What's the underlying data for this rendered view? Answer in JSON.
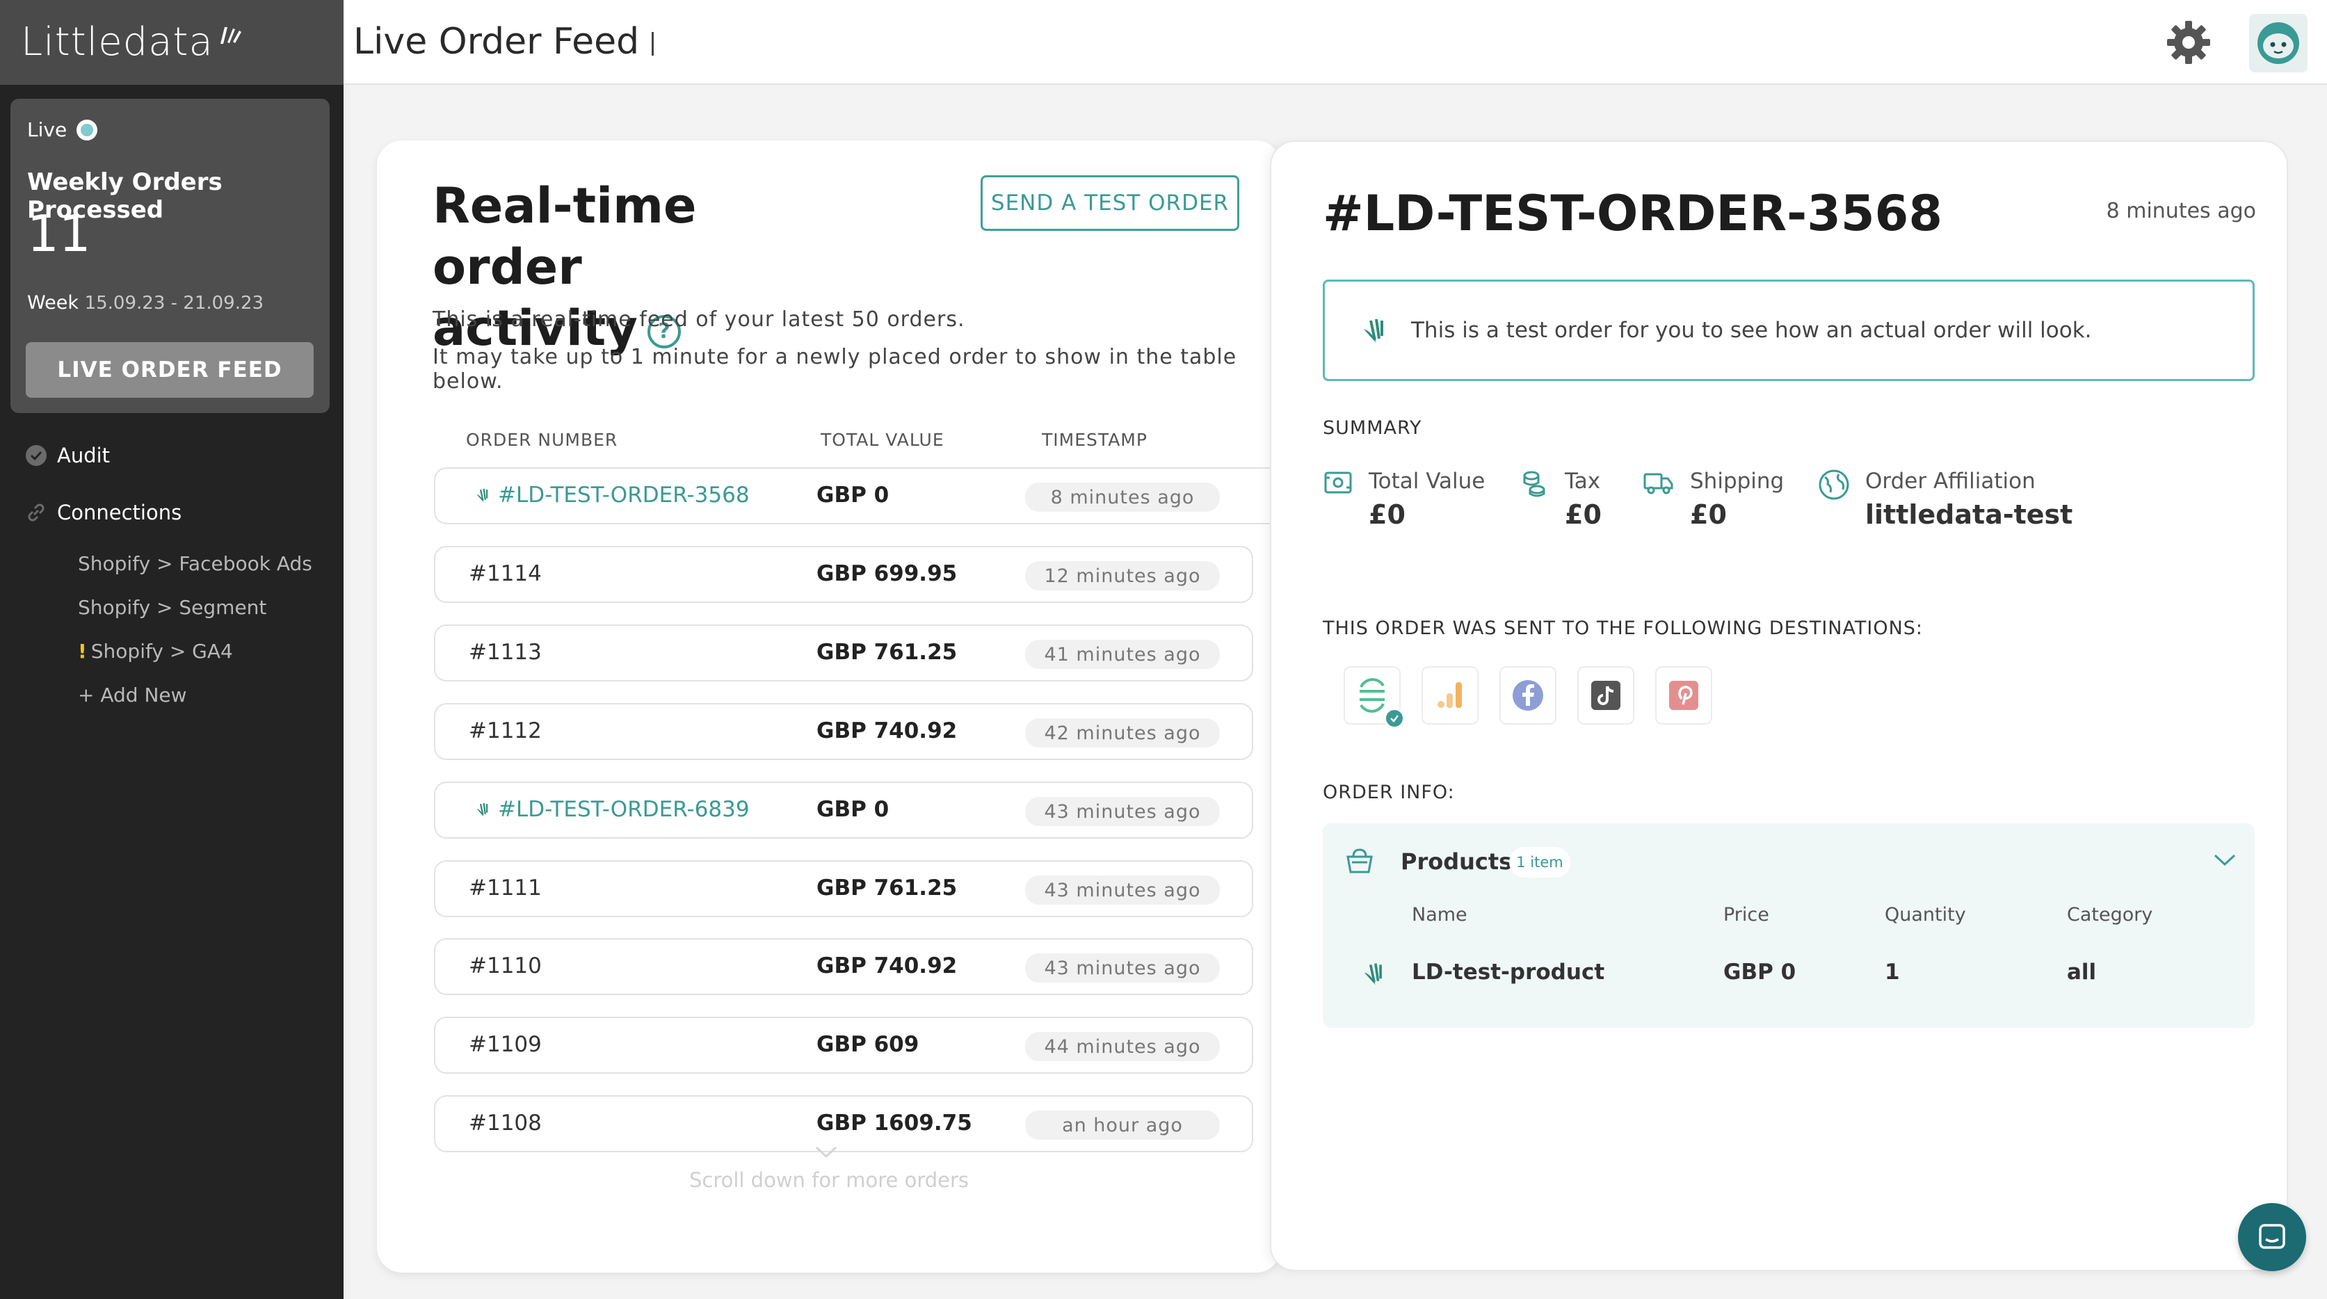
{
  "app": {
    "logo": "Littledata",
    "page_title": "Live Order Feed"
  },
  "sidebar": {
    "live_label": "Live",
    "stat_title": "Weekly Orders Processed",
    "stat_value": "11",
    "week_label": "Week",
    "week_dates": "15.09.23 - 21.09.23",
    "live_feed_button": "LIVE ORDER FEED",
    "nav": [
      {
        "label": "Audit",
        "icon": "check-circle-icon"
      },
      {
        "label": "Connections",
        "icon": "link-icon"
      }
    ],
    "connections": [
      {
        "label": "Shopify > Facebook Ads",
        "warning": ""
      },
      {
        "label": "Shopify > Segment",
        "warning": ""
      },
      {
        "label": "Shopify > GA4",
        "warning": "!"
      },
      {
        "label": "+ Add New",
        "warning": ""
      }
    ]
  },
  "feed": {
    "title_line1": "Real-time order",
    "title_line2": "activity",
    "help_glyph": "?",
    "send_test_button": "SEND A TEST ORDER",
    "desc1": "This is a real-time feed of your latest 50 orders.",
    "desc2": "It may take up to 1 minute for a newly placed order to show in the table below.",
    "columns": [
      "ORDER NUMBER",
      "TOTAL VALUE",
      "TIMESTAMP"
    ],
    "rows": [
      {
        "order": "#LD-TEST-ORDER-3568",
        "value": "GBP 0",
        "time": "8 minutes ago",
        "test": true,
        "selected": true
      },
      {
        "order": "#1114",
        "value": "GBP 699.95",
        "time": "12 minutes ago",
        "test": false,
        "selected": false
      },
      {
        "order": "#1113",
        "value": "GBP 761.25",
        "time": "41 minutes ago",
        "test": false,
        "selected": false
      },
      {
        "order": "#1112",
        "value": "GBP 740.92",
        "time": "42 minutes ago",
        "test": false,
        "selected": false
      },
      {
        "order": "#LD-TEST-ORDER-6839",
        "value": "GBP 0",
        "time": "43 minutes ago",
        "test": true,
        "selected": false
      },
      {
        "order": "#1111",
        "value": "GBP 761.25",
        "time": "43 minutes ago",
        "test": false,
        "selected": false
      },
      {
        "order": "#1110",
        "value": "GBP 740.92",
        "time": "43 minutes ago",
        "test": false,
        "selected": false
      },
      {
        "order": "#1109",
        "value": "GBP 609",
        "time": "44 minutes ago",
        "test": false,
        "selected": false
      },
      {
        "order": "#1108",
        "value": "GBP 1609.75",
        "time": "an hour ago",
        "test": false,
        "selected": false
      }
    ],
    "scroll_more": "Scroll down for more orders"
  },
  "detail": {
    "order_id": "#LD-TEST-ORDER-3568",
    "ago": "8 minutes ago",
    "notice": "This is a test order for you to see how an actual order will look.",
    "summary_label": "SUMMARY",
    "summary": [
      {
        "label": "Total Value",
        "value": "£0",
        "icon": "money-icon"
      },
      {
        "label": "Tax",
        "value": "£0",
        "icon": "coins-icon"
      },
      {
        "label": "Shipping",
        "value": "£0",
        "icon": "truck-icon"
      },
      {
        "label": "Order Affiliation",
        "value": "littledata-test",
        "icon": "globe-icon"
      }
    ],
    "destinations_label": "THIS ORDER WAS SENT TO THE FOLLOWING DESTINATIONS:",
    "destinations": [
      "segment-icon",
      "ga4-icon",
      "facebook-icon",
      "tiktok-icon",
      "pinterest-icon"
    ],
    "order_info_label": "ORDER INFO:",
    "products": {
      "title": "Products",
      "badge": "1 item",
      "columns": [
        "Name",
        "Price",
        "Quantity",
        "Category"
      ],
      "items": [
        {
          "name": "LD-test-product",
          "price": "GBP 0",
          "quantity": "1",
          "category": "all"
        }
      ]
    }
  },
  "colors": {
    "accent": "#3a9a94",
    "sidebar_bg": "#232323",
    "card_bg": "#4e4e4e"
  }
}
